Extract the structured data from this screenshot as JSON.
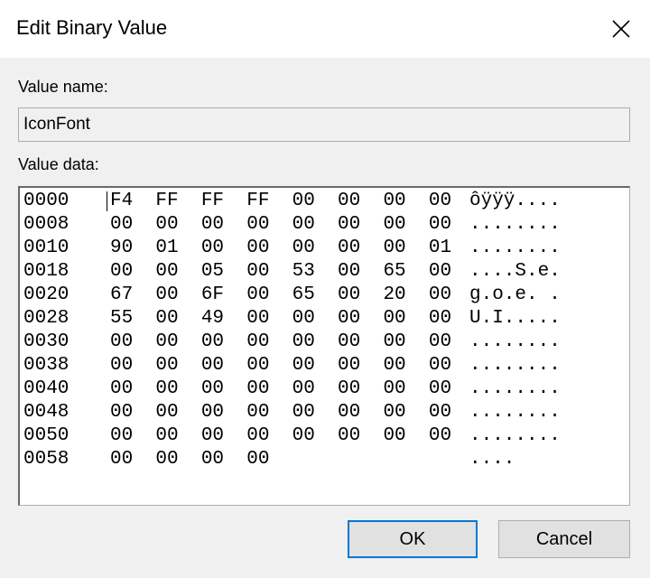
{
  "dialog": {
    "title": "Edit Binary Value",
    "close_glyph": "close-icon"
  },
  "value_name": {
    "label": "Value name:",
    "value": "IconFont"
  },
  "value_data": {
    "label": "Value data:",
    "rows": [
      {
        "offset": "0000",
        "bytes": "F4  FF  FF  FF  00  00  00  00",
        "ascii": "ôÿÿÿ...."
      },
      {
        "offset": "0008",
        "bytes": "00  00  00  00  00  00  00  00",
        "ascii": "........"
      },
      {
        "offset": "0010",
        "bytes": "90  01  00  00  00  00  00  01",
        "ascii": "........"
      },
      {
        "offset": "0018",
        "bytes": "00  00  05  00  53  00  65  00",
        "ascii": "....S.e."
      },
      {
        "offset": "0020",
        "bytes": "67  00  6F  00  65  00  20  00",
        "ascii": "g.o.e. ."
      },
      {
        "offset": "0028",
        "bytes": "55  00  49  00  00  00  00  00",
        "ascii": "U.I....."
      },
      {
        "offset": "0030",
        "bytes": "00  00  00  00  00  00  00  00",
        "ascii": "........"
      },
      {
        "offset": "0038",
        "bytes": "00  00  00  00  00  00  00  00",
        "ascii": "........"
      },
      {
        "offset": "0040",
        "bytes": "00  00  00  00  00  00  00  00",
        "ascii": "........"
      },
      {
        "offset": "0048",
        "bytes": "00  00  00  00  00  00  00  00",
        "ascii": "........"
      },
      {
        "offset": "0050",
        "bytes": "00  00  00  00  00  00  00  00",
        "ascii": "........"
      },
      {
        "offset": "0058",
        "bytes": "00  00  00  00",
        "ascii": "...."
      }
    ]
  },
  "buttons": {
    "ok": "OK",
    "cancel": "Cancel"
  },
  "colors": {
    "dialog_bg": "#f0f0f0",
    "title_bg": "#ffffff",
    "default_button_border": "#0078d7"
  }
}
